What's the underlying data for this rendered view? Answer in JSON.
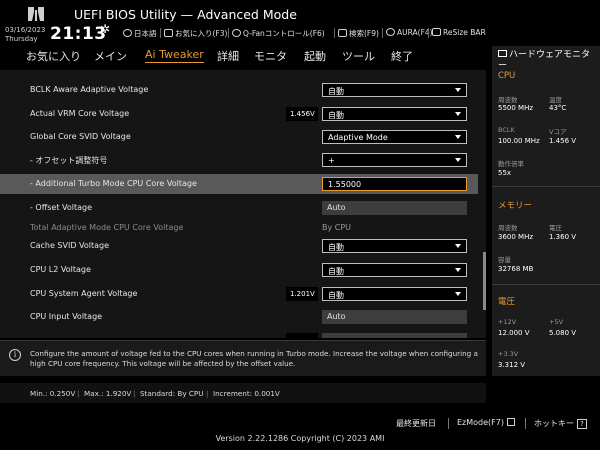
{
  "app": {
    "title": "UEFI BIOS Utility — Advanced Mode",
    "date": "03/16/2023",
    "weekday": "Thursday",
    "time": "21:13"
  },
  "toolbar": {
    "language": "日本語",
    "favorites": "お気に入り(F3)",
    "qfan": "Q-Fanコントロール(F6)",
    "search": "検索(F9)",
    "aura": "AURA(F4)",
    "resize_bar": "ReSize BAR"
  },
  "menu": {
    "items": [
      "お気に入り",
      "メイン",
      "Ai Tweaker",
      "詳細",
      "モニタ",
      "起動",
      "ツール",
      "終了"
    ],
    "active": "Ai Tweaker"
  },
  "settings": [
    {
      "label": "BCLK Aware Adaptive Voltage",
      "type": "dropdown",
      "value": "自動"
    },
    {
      "label": "Actual VRM Core Voltage",
      "type": "dropdown",
      "value": "自動",
      "current": "1.456V"
    },
    {
      "label": "Global Core SVID Voltage",
      "type": "dropdown",
      "value": "Adaptive Mode"
    },
    {
      "label": "- オフセット調整符号",
      "type": "dropdown",
      "value": "+"
    },
    {
      "label": "- Additional Turbo Mode CPU Core Voltage",
      "type": "text",
      "value": "1.55000",
      "highlighted": true
    },
    {
      "label": "- Offset Voltage",
      "type": "readonly",
      "value": "Auto"
    },
    {
      "label": "Total Adaptive Mode CPU Core Voltage",
      "type": "plain",
      "value": "By CPU",
      "dim": true
    },
    {
      "label": "Cache SVID Voltage",
      "type": "dropdown",
      "value": "自動"
    },
    {
      "label": "CPU L2 Voltage",
      "type": "dropdown",
      "value": "自動"
    },
    {
      "label": "CPU System Agent Voltage",
      "type": "dropdown",
      "value": "自動",
      "current": "1.201V"
    },
    {
      "label": "CPU Input Voltage",
      "type": "readonly",
      "value": "Auto"
    }
  ],
  "help": {
    "text": "Configure the amount of voltage fed to the CPU cores when running in Turbo mode. Increase the voltage when configuring a high CPU core frequency. This voltage will be affected by the offset value."
  },
  "range": {
    "min": "Min.: 0.250V",
    "max": "Max.: 1.920V",
    "standard": "Standard: By CPU",
    "increment": "Increment: 0.001V"
  },
  "hw_monitor": {
    "title": "ハードウェアモニター",
    "cpu": {
      "section": "CPU",
      "freq_label": "周波数",
      "freq": "5500 MHz",
      "temp_label": "温度",
      "temp": "43°C",
      "bclk_label": "BCLK",
      "bclk": "100.00 MHz",
      "vcore_label": "Vコア",
      "vcore": "1.456 V",
      "ratio_label": "動作倍率",
      "ratio": "55x"
    },
    "memory": {
      "section": "メモリー",
      "freq_label": "周波数",
      "freq": "3600 MHz",
      "volt_label": "電圧",
      "volt": "1.360 V",
      "cap_label": "容量",
      "cap": "32768 MB"
    },
    "voltage": {
      "section": "電圧",
      "v12_label": "+12V",
      "v12": "12.000 V",
      "v5_label": "+5V",
      "v5": "5.080 V",
      "v33_label": "+3.3V",
      "v33": "3.312 V"
    }
  },
  "bottom": {
    "last_modified": "最終更新日",
    "ezmode": "EzMode(F7)",
    "hotkeys": "ホットキー",
    "hotkey_mark": "?",
    "version": "Version 2.22.1286 Copyright (C) 2023 AMI"
  },
  "colors": {
    "accent": "#e89a2e",
    "highlight_row": "#595959",
    "panel_bg": "#151515"
  }
}
